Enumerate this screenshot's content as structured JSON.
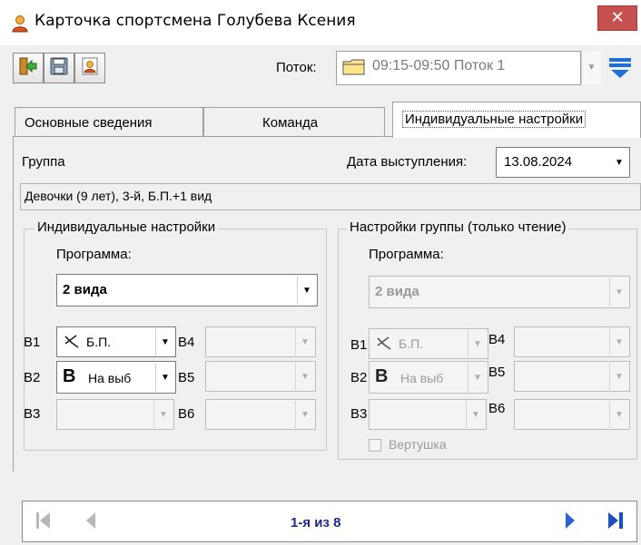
{
  "window": {
    "title": "Карточка спортсмена Голубева Ксения",
    "close_label": "✕"
  },
  "toolbar": {
    "stream_label": "Поток:",
    "stream_value": "09:15-09:50 Поток 1"
  },
  "tabs": [
    {
      "label": "Основные сведения"
    },
    {
      "label": "Команда"
    },
    {
      "label": "Индивидуальные настройки"
    }
  ],
  "main": {
    "group_label": "Группа",
    "date_label": "Дата выступления:",
    "date_value": "13.08.2024",
    "group_value": "Девочки (9 лет), 3-й, Б.П.+1 вид"
  },
  "individual": {
    "title": "Индивидуальные настройки",
    "program_label": "Программа:",
    "program_value": "2 вида",
    "slots": {
      "b1": {
        "label": "В1",
        "value": "Б.П."
      },
      "b2": {
        "label": "В2",
        "value": "На выб"
      },
      "b3": {
        "label": "В3",
        "value": ""
      },
      "b4": {
        "label": "В4",
        "value": ""
      },
      "b5": {
        "label": "В5",
        "value": ""
      },
      "b6": {
        "label": "В6",
        "value": ""
      }
    },
    "b2_icon_letter": "В"
  },
  "groupsettings": {
    "title": "Настройки группы (только чтение)",
    "program_label": "Программа:",
    "program_value": "2 вида",
    "slots": {
      "b1": {
        "label": "В1",
        "value": "Б.П."
      },
      "b2": {
        "label": "В2",
        "value": "На выб"
      },
      "b3": {
        "label": "В3",
        "value": ""
      },
      "b4": {
        "label": "В4",
        "value": ""
      },
      "b5": {
        "label": "В5",
        "value": ""
      },
      "b6": {
        "label": "В6",
        "value": ""
      }
    },
    "b2_icon_letter": "В",
    "spinner_label": "Вертушка"
  },
  "nav": {
    "record_text": "1-я из 8"
  },
  "colors": {
    "close_red": "#c75050",
    "nav_text": "#1a2a8a",
    "nav_arrow": "#2a63d8"
  }
}
